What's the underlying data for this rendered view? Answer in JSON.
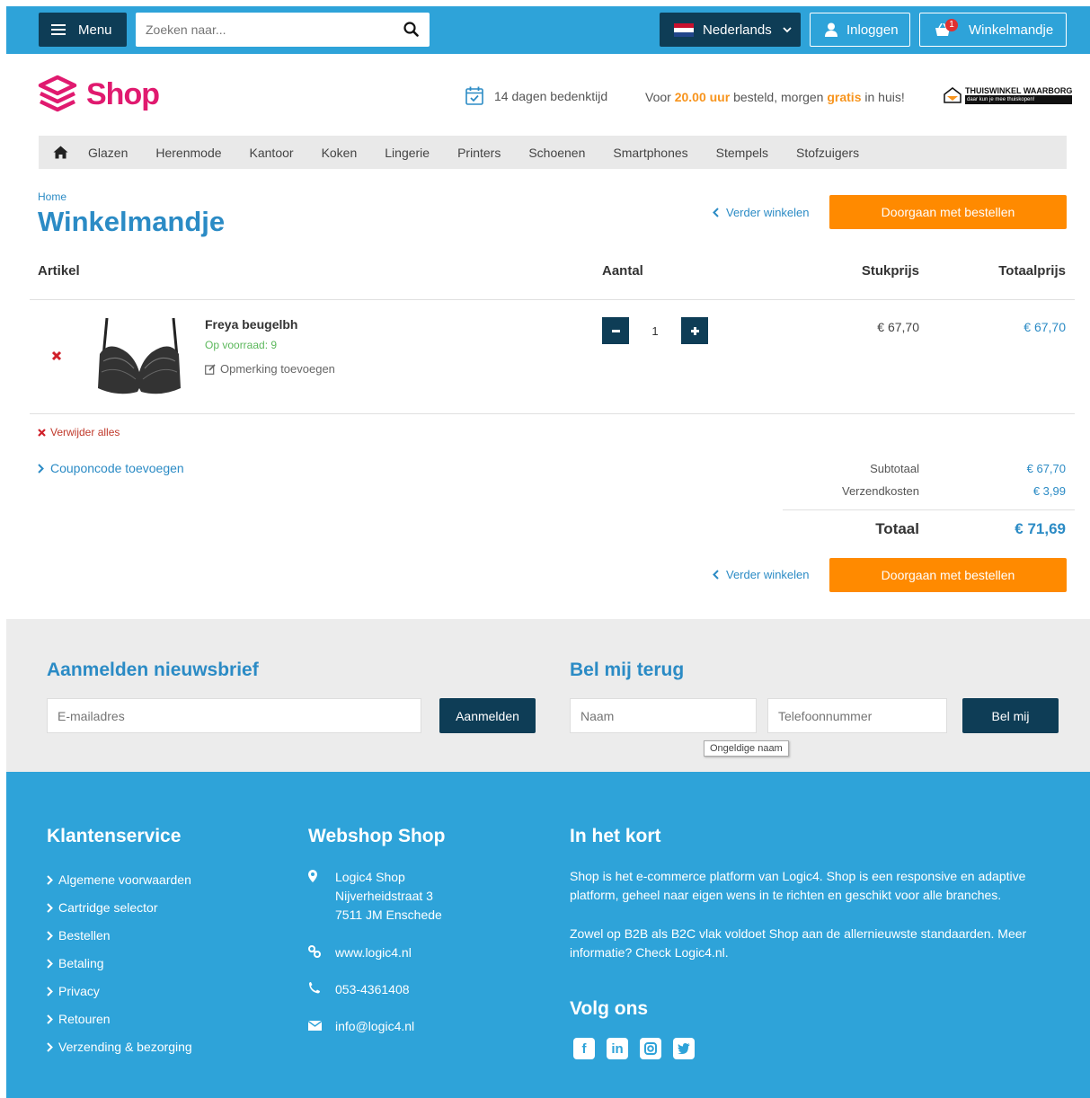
{
  "topbar": {
    "menu_label": "Menu",
    "search_placeholder": "Zoeken naar...",
    "language_label": "Nederlands",
    "login_label": "Inloggen",
    "cart_label": "Winkelmandje",
    "cart_count": "1"
  },
  "header": {
    "logo_text": "Shop",
    "usp_return": "14 dagen bedenktijd",
    "usp_delivery_pre": "Voor ",
    "usp_delivery_time": "20.00 uur",
    "usp_delivery_mid": " besteld, morgen ",
    "usp_delivery_free": "gratis",
    "usp_delivery_post": " in huis!",
    "waarborg_title": "THUISWINKEL WAARBORG",
    "waarborg_sub": "daar kun je mee thuiskopen!"
  },
  "nav": {
    "items": [
      "Glazen",
      "Herenmode",
      "Kantoor",
      "Koken",
      "Lingerie",
      "Printers",
      "Schoenen",
      "Smartphones",
      "Stempels",
      "Stofzuigers"
    ]
  },
  "cart": {
    "breadcrumb": "Home",
    "title": "Winkelmandje",
    "continue_label": "Verder winkelen",
    "order_label": "Doorgaan met bestellen",
    "col_article": "Artikel",
    "col_qty": "Aantal",
    "col_unit": "Stukprijs",
    "col_total": "Totaalprijs",
    "item": {
      "name": "Freya beugelbh",
      "stock": "Op voorraad: 9",
      "note": "Opmerking toevoegen",
      "quantity": "1",
      "unit_price": "€ 67,70",
      "total_price": "€ 67,70"
    },
    "remove_all": "Verwijder alles",
    "coupon": "Couponcode toevoegen",
    "subtotal_label": "Subtotaal",
    "subtotal": "€ 67,70",
    "shipping_label": "Verzendkosten",
    "shipping": "€ 3,99",
    "total_label": "Totaal",
    "total": "€ 71,69"
  },
  "newsletter": {
    "title": "Aanmelden nieuwsbrief",
    "email_placeholder": "E-mailadres",
    "button": "Aanmelden"
  },
  "callback": {
    "title": "Bel mij terug",
    "name_placeholder": "Naam",
    "phone_placeholder": "Telefoonnummer",
    "button": "Bel mij",
    "tooltip": "Ongeldige naam"
  },
  "footer": {
    "service_title": "Klantenservice",
    "service_links": [
      "Algemene voorwaarden",
      "Cartridge selector",
      "Bestellen",
      "Betaling",
      "Privacy",
      "Retouren",
      "Verzending & bezorging"
    ],
    "shop_title": "Webshop Shop",
    "address": [
      "Logic4 Shop",
      "Nijverheidstraat 3",
      "7511 JM Enschede"
    ],
    "website": "www.logic4.nl",
    "phone": "053-4361408",
    "email": "info@logic4.nl",
    "about_title": "In het kort",
    "about_p1": "Shop is het e-commerce platform van Logic4. Shop is een responsive en adaptive platform, geheel naar eigen wens in te richten en geschikt voor alle branches.",
    "about_p2": "Zowel op B2B als B2C vlak voldoet Shop aan de allernieuwste standaarden. Meer informatie? Check Logic4.nl.",
    "follow_title": "Volg ons",
    "social": [
      "facebook-icon",
      "linkedin-icon",
      "instagram-icon",
      "twitter-icon"
    ]
  },
  "colors": {
    "primary_blue": "#2ea3d9",
    "dark_navy": "#0e3d56",
    "accent_orange": "#ff8a00",
    "logo_pink": "#e01a6f",
    "link_blue": "#2b8bc5"
  }
}
